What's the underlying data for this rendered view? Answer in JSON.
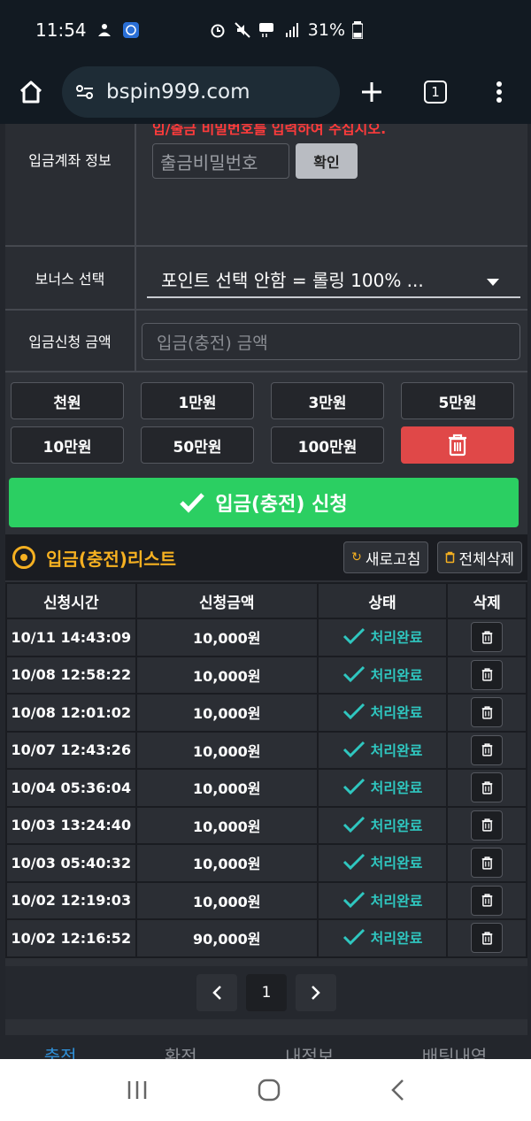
{
  "status_bar": {
    "time": "11:54",
    "battery": "31%"
  },
  "browser": {
    "url": "bspin999.com",
    "tab_count": "1"
  },
  "form": {
    "account_info_label": "입금계좌 정보",
    "red_note": "입/출금 비밀번호를 입력하여 주십시오.",
    "password_placeholder": "출금비밀번호",
    "confirm_label": "확인",
    "bonus_label": "보너스 선택",
    "bonus_selected": "포인트 선택 안함 = 롤링 100% ...",
    "amount_label": "입금신청 금액",
    "amount_placeholder": "입금(충전) 금액"
  },
  "amount_buttons": [
    "천원",
    "1만원",
    "3만원",
    "5만원",
    "10만원",
    "50만원",
    "100만원"
  ],
  "submit_label": "입금(충전) 신청",
  "list": {
    "title": "입금(충전)리스트",
    "refresh_label": "새로고침",
    "delete_all_label": "전체삭제",
    "columns": [
      "신청시간",
      "신청금액",
      "상태",
      "삭제"
    ],
    "rows": [
      {
        "time": "10/11 14:43:09",
        "amount": "10,000원",
        "status": "처리완료"
      },
      {
        "time": "10/08 12:58:22",
        "amount": "10,000원",
        "status": "처리완료"
      },
      {
        "time": "10/08 12:01:02",
        "amount": "10,000원",
        "status": "처리완료"
      },
      {
        "time": "10/07 12:43:26",
        "amount": "10,000원",
        "status": "처리완료"
      },
      {
        "time": "10/04 05:36:04",
        "amount": "10,000원",
        "status": "처리완료"
      },
      {
        "time": "10/03 13:24:40",
        "amount": "10,000원",
        "status": "처리완료"
      },
      {
        "time": "10/03 05:40:32",
        "amount": "10,000원",
        "status": "처리완료"
      },
      {
        "time": "10/02 12:19:03",
        "amount": "10,000원",
        "status": "처리완료"
      },
      {
        "time": "10/02 12:16:52",
        "amount": "90,000원",
        "status": "처리완료"
      }
    ]
  },
  "pagination": {
    "current": "1"
  },
  "bottom_tabs": [
    "충전",
    "환전",
    "내정보",
    "배팅내역"
  ],
  "colors": {
    "accent_green": "#2bcf62",
    "accent_orange": "#f5b021",
    "status_teal": "#2fc7c0",
    "delete_red": "#e04848"
  }
}
